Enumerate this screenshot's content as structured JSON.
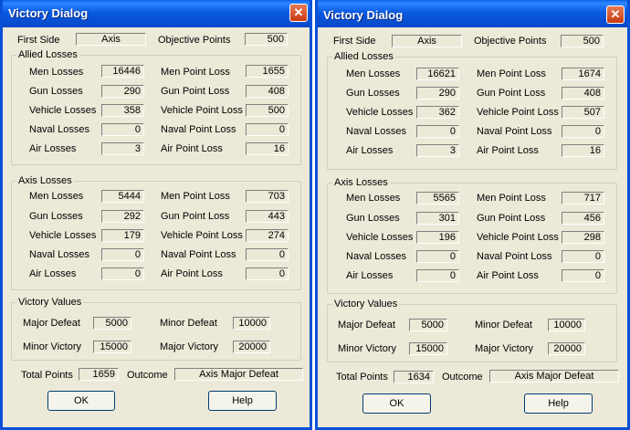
{
  "dialogs": [
    {
      "title": "Victory Dialog",
      "close_symbol": "✕",
      "first_side_label": "First Side",
      "first_side_value": "Axis",
      "objective_points_label": "Objective Points",
      "objective_points_value": "500",
      "allied": {
        "title": "Allied Losses",
        "rows": [
          {
            "label": "Men Losses",
            "value": "16446",
            "point_label": "Men Point Loss",
            "point_value": "1655"
          },
          {
            "label": "Gun Losses",
            "value": "290",
            "point_label": "Gun Point Loss",
            "point_value": "408"
          },
          {
            "label": "Vehicle Losses",
            "value": "358",
            "point_label": "Vehicle Point Loss",
            "point_value": "500"
          },
          {
            "label": "Naval Losses",
            "value": "0",
            "point_label": "Naval Point Loss",
            "point_value": "0"
          },
          {
            "label": "Air Losses",
            "value": "3",
            "point_label": "Air Point Loss",
            "point_value": "16"
          }
        ]
      },
      "axis": {
        "title": "Axis Losses",
        "rows": [
          {
            "label": "Men Losses",
            "value": "5444",
            "point_label": "Men Point Loss",
            "point_value": "703"
          },
          {
            "label": "Gun Losses",
            "value": "292",
            "point_label": "Gun Point Loss",
            "point_value": "443"
          },
          {
            "label": "Vehicle Losses",
            "value": "179",
            "point_label": "Vehicle Point Loss",
            "point_value": "274"
          },
          {
            "label": "Naval Losses",
            "value": "0",
            "point_label": "Naval Point Loss",
            "point_value": "0"
          },
          {
            "label": "Air Losses",
            "value": "0",
            "point_label": "Air Point Loss",
            "point_value": "0"
          }
        ]
      },
      "victory": {
        "title": "Victory Values",
        "major_defeat_label": "Major Defeat",
        "major_defeat_value": "5000",
        "minor_defeat_label": "Minor Defeat",
        "minor_defeat_value": "10000",
        "minor_victory_label": "Minor Victory",
        "minor_victory_value": "15000",
        "major_victory_label": "Major Victory",
        "major_victory_value": "20000"
      },
      "total_points_label": "Total Points",
      "total_points_value": "1659",
      "outcome_label": "Outcome",
      "outcome_value": "Axis Major Defeat",
      "ok_label": "OK",
      "help_label": "Help"
    },
    {
      "title": "Victory Dialog",
      "close_symbol": "✕",
      "first_side_label": "First Side",
      "first_side_value": "Axis",
      "objective_points_label": "Objective Points",
      "objective_points_value": "500",
      "allied": {
        "title": "Allied Losses",
        "rows": [
          {
            "label": "Men Losses",
            "value": "16621",
            "point_label": "Men Point Loss",
            "point_value": "1674"
          },
          {
            "label": "Gun Losses",
            "value": "290",
            "point_label": "Gun Point Loss",
            "point_value": "408"
          },
          {
            "label": "Vehicle Losses",
            "value": "362",
            "point_label": "Vehicle Point Loss",
            "point_value": "507"
          },
          {
            "label": "Naval Losses",
            "value": "0",
            "point_label": "Naval Point Loss",
            "point_value": "0"
          },
          {
            "label": "Air Losses",
            "value": "3",
            "point_label": "Air Point Loss",
            "point_value": "16"
          }
        ]
      },
      "axis": {
        "title": "Axis Losses",
        "rows": [
          {
            "label": "Men Losses",
            "value": "5565",
            "point_label": "Men Point Loss",
            "point_value": "717"
          },
          {
            "label": "Gun Losses",
            "value": "301",
            "point_label": "Gun Point Loss",
            "point_value": "456"
          },
          {
            "label": "Vehicle Losses",
            "value": "196",
            "point_label": "Vehicle Point Loss",
            "point_value": "298"
          },
          {
            "label": "Naval Losses",
            "value": "0",
            "point_label": "Naval Point Loss",
            "point_value": "0"
          },
          {
            "label": "Air Losses",
            "value": "0",
            "point_label": "Air Point Loss",
            "point_value": "0"
          }
        ]
      },
      "victory": {
        "title": "Victory Values",
        "major_defeat_label": "Major Defeat",
        "major_defeat_value": "5000",
        "minor_defeat_label": "Minor Defeat",
        "minor_defeat_value": "10000",
        "minor_victory_label": "Minor Victory",
        "minor_victory_value": "15000",
        "major_victory_label": "Major Victory",
        "major_victory_value": "20000"
      },
      "total_points_label": "Total Points",
      "total_points_value": "1634",
      "outcome_label": "Outcome",
      "outcome_value": "Axis Major Defeat",
      "ok_label": "OK",
      "help_label": "Help"
    }
  ]
}
